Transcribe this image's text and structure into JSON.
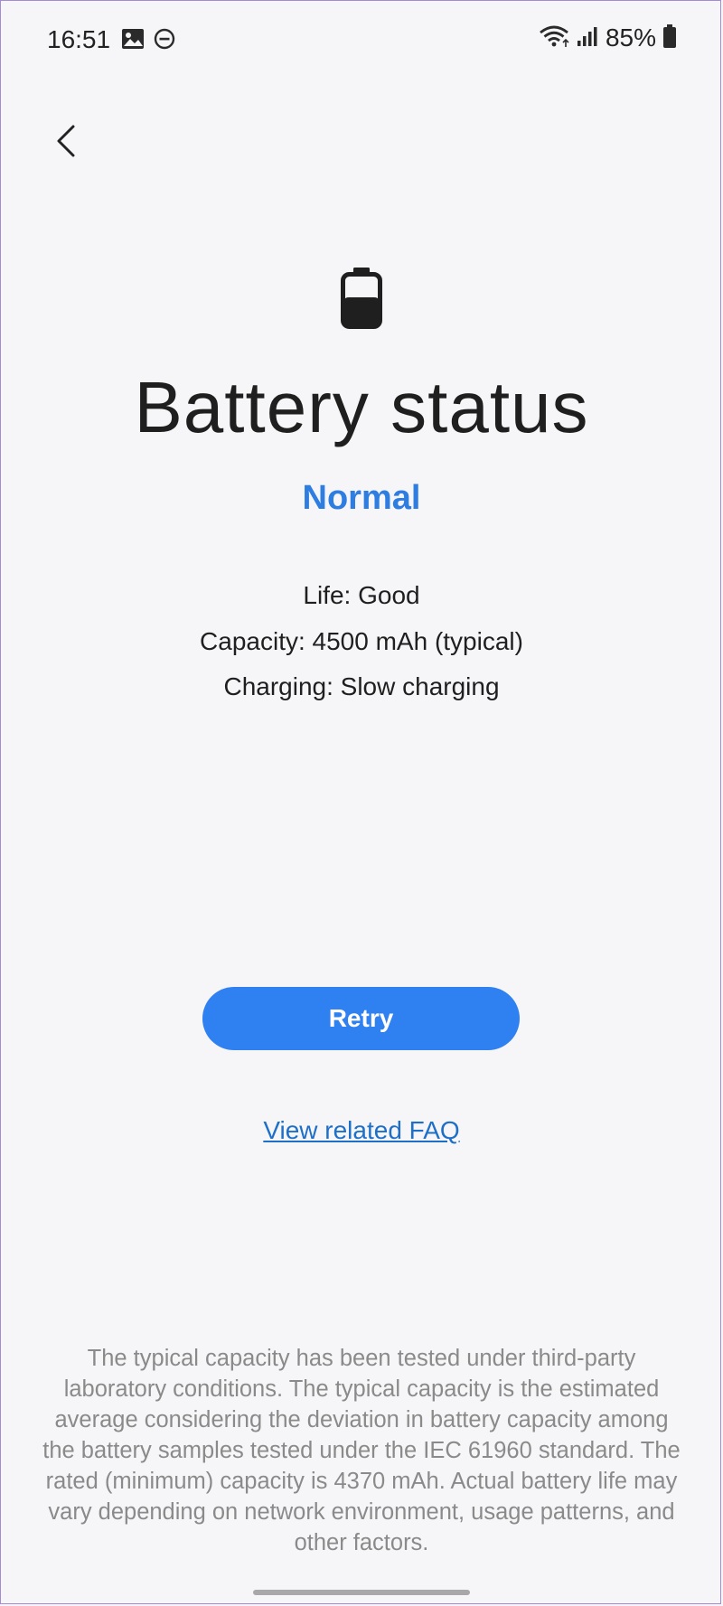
{
  "status_bar": {
    "time": "16:51",
    "battery_percent": "85%",
    "icons": [
      "image-icon",
      "do-not-disturb-icon",
      "wifi-icon",
      "signal-icon",
      "battery-icon"
    ]
  },
  "header": {
    "back_icon": "chevron-left-icon"
  },
  "main": {
    "title": "Battery status",
    "status": "Normal",
    "details": [
      "Life: Good",
      "Capacity: 4500 mAh (typical)",
      "Charging: Slow charging"
    ],
    "retry_label": "Retry",
    "faq_label": "View related FAQ",
    "disclaimer": "The typical capacity has been tested under third-party laboratory conditions. The typical capacity is the estimated average considering the deviation in battery capacity among the battery samples tested under the IEC 61960 standard. The rated (minimum) capacity is 4370 mAh. Actual battery life may vary depending on network environment, usage patterns, and other factors."
  },
  "colors": {
    "accent": "#2f80f0",
    "status_text": "#2e7de1",
    "link": "#1e6fc7",
    "background": "#f6f6f8"
  }
}
